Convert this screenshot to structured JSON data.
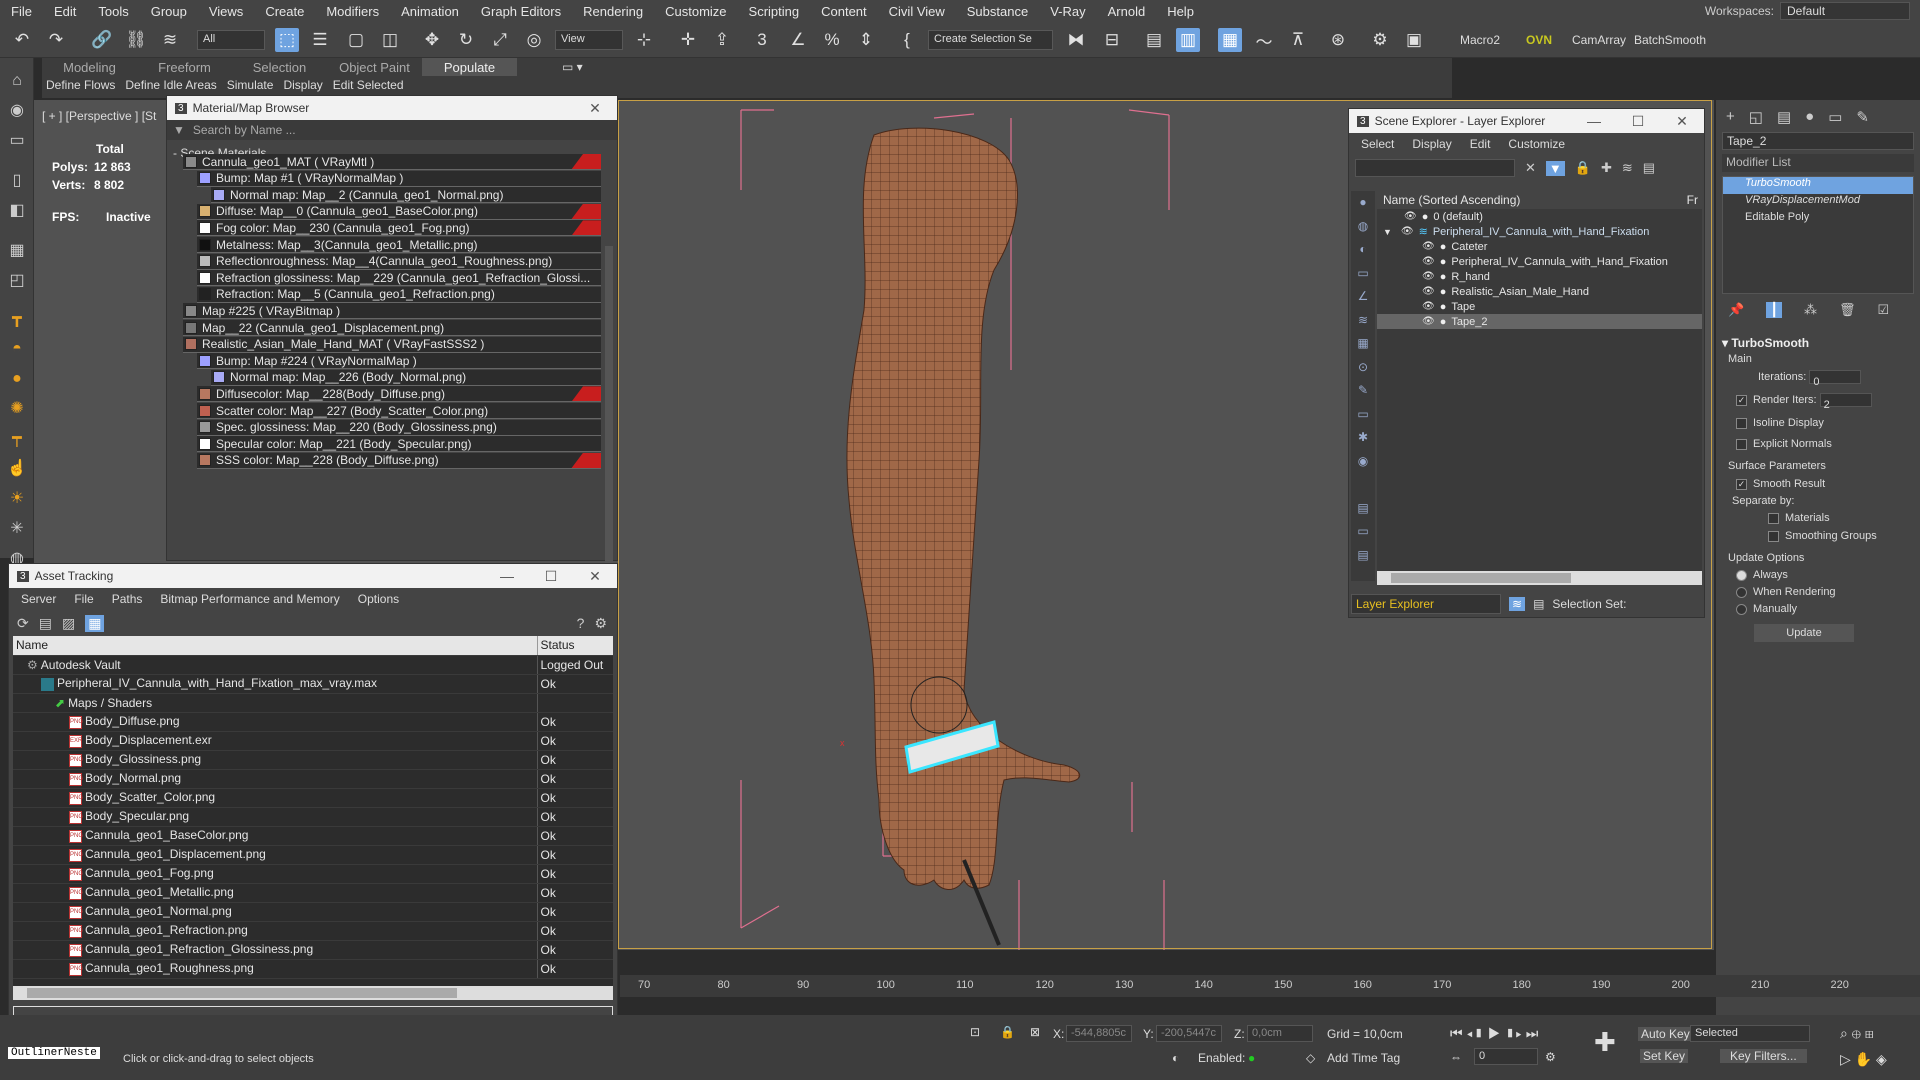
{
  "menubar": {
    "items": [
      "File",
      "Edit",
      "Tools",
      "Group",
      "Views",
      "Create",
      "Modifiers",
      "Animation",
      "Graph Editors",
      "Rendering",
      "Customize",
      "Scripting",
      "Content",
      "Civil View",
      "Substance",
      "V-Ray",
      "Arnold",
      "Help"
    ],
    "workspaces_label": "Workspaces:",
    "workspaces_value": "Default"
  },
  "toolbar": {
    "filter_value": "All",
    "view_value": "View",
    "selection_set": "Create Selection Se",
    "macro2": "Macro2",
    "ovn": "OVN",
    "camarray": "CamArray",
    "batchsmooth": "BatchSmooth"
  },
  "ribbon": {
    "tabs": [
      "Modeling",
      "Freeform",
      "Selection",
      "Object Paint",
      "Populate"
    ],
    "subitems": [
      "Define Flows",
      "Define Idle Areas",
      "Simulate",
      "Display",
      "Edit Selected"
    ]
  },
  "viewport": {
    "label": "[ + ] [Perspective ] [St",
    "stats": {
      "total": "Total",
      "polys_label": "Polys:",
      "polys": "12 863",
      "verts_label": "Verts:",
      "verts": "8 802",
      "fps_label": "FPS:",
      "fps": "Inactive"
    }
  },
  "material_browser": {
    "title": "Material/Map Browser",
    "search_placeholder": "Search by Name ...",
    "section": "- Scene Materials",
    "rows": [
      {
        "text": "Cannula_geo1_MAT  ( VRayMtl )",
        "indent": 0,
        "red": true,
        "swatch": "#8a8a8a"
      },
      {
        "text": "Bump: Map #1  ( VRayNormalMap )",
        "indent": 1,
        "red": false,
        "swatch": "#9da0ff"
      },
      {
        "text": "Normal map: Map__2 (Cannula_geo1_Normal.png)",
        "indent": 2,
        "red": false,
        "swatch": "#a8aaf5"
      },
      {
        "text": "Diffuse: Map__0 (Cannula_geo1_BaseColor.png)",
        "indent": 1,
        "red": true,
        "swatch": "#d8b070"
      },
      {
        "text": "Fog color: Map__230 (Cannula_geo1_Fog.png)",
        "indent": 1,
        "red": true,
        "swatch": "#ffffff"
      },
      {
        "text": "Metalness: Map__3(Cannula_geo1_Metallic.png)",
        "indent": 1,
        "red": false,
        "swatch": "#111111"
      },
      {
        "text": "Reflectionroughness: Map__4(Cannula_geo1_Roughness.png)",
        "indent": 1,
        "red": false,
        "swatch": "#bbbbbb"
      },
      {
        "text": "Refraction glossiness: Map__229 (Cannula_geo1_Refraction_Glossi...",
        "indent": 1,
        "red": false,
        "swatch": "#ffffff"
      },
      {
        "text": "Refraction: Map__5 (Cannula_geo1_Refraction.png)",
        "indent": 1,
        "red": false,
        "swatch": "#222222"
      },
      {
        "text": "Map #225  ( VRayBitmap )",
        "indent": 0,
        "red": false,
        "swatch": "#888888"
      },
      {
        "text": "Map__22 (Cannula_geo1_Displacement.png)",
        "indent": 0,
        "red": false,
        "swatch": "#777777"
      },
      {
        "text": "Realistic_Asian_Male_Hand_MAT  ( VRayFastSSS2 )",
        "indent": 0,
        "red": false,
        "swatch": "#b07060"
      },
      {
        "text": "Bump: Map #224  ( VRayNormalMap )",
        "indent": 1,
        "red": false,
        "swatch": "#9da0ff"
      },
      {
        "text": "Normal map: Map__226 (Body_Normal.png)",
        "indent": 2,
        "red": false,
        "swatch": "#a8aaf5"
      },
      {
        "text": "Diffusecolor: Map__228(Body_Diffuse.png)",
        "indent": 1,
        "red": true,
        "swatch": "#b87860"
      },
      {
        "text": "Scatter color: Map__227 (Body_Scatter_Color.png)",
        "indent": 1,
        "red": false,
        "swatch": "#c06050"
      },
      {
        "text": "Spec. glossiness: Map__220 (Body_Glossiness.png)",
        "indent": 1,
        "red": false,
        "swatch": "#999999"
      },
      {
        "text": "Specular color: Map__221 (Body_Specular.png)",
        "indent": 1,
        "red": false,
        "swatch": "#ffffff"
      },
      {
        "text": "SSS color: Map__228 (Body_Diffuse.png)",
        "indent": 1,
        "red": true,
        "swatch": "#b87860"
      }
    ]
  },
  "asset_tracking": {
    "title": "Asset Tracking",
    "menu": [
      "Server",
      "File",
      "Paths",
      "Bitmap Performance and Memory",
      "Options"
    ],
    "col_name": "Name",
    "col_status": "Status",
    "rows": [
      {
        "name": "Autodesk Vault",
        "status": "Logged Out",
        "indent": 1,
        "icon": "vault"
      },
      {
        "name": "Peripheral_IV_Cannula_with_Hand_Fixation_max_vray.max",
        "status": "Ok",
        "indent": 2,
        "icon": "max"
      },
      {
        "name": "Maps / Shaders",
        "status": "",
        "indent": 3,
        "icon": "folder"
      },
      {
        "name": "Body_Diffuse.png",
        "status": "Ok",
        "indent": 4,
        "icon": "png"
      },
      {
        "name": "Body_Displacement.exr",
        "status": "Ok",
        "indent": 4,
        "icon": "exr"
      },
      {
        "name": "Body_Glossiness.png",
        "status": "Ok",
        "indent": 4,
        "icon": "png"
      },
      {
        "name": "Body_Normal.png",
        "status": "Ok",
        "indent": 4,
        "icon": "png"
      },
      {
        "name": "Body_Scatter_Color.png",
        "status": "Ok",
        "indent": 4,
        "icon": "png"
      },
      {
        "name": "Body_Specular.png",
        "status": "Ok",
        "indent": 4,
        "icon": "png"
      },
      {
        "name": "Cannula_geo1_BaseColor.png",
        "status": "Ok",
        "indent": 4,
        "icon": "png"
      },
      {
        "name": "Cannula_geo1_Displacement.png",
        "status": "Ok",
        "indent": 4,
        "icon": "png"
      },
      {
        "name": "Cannula_geo1_Fog.png",
        "status": "Ok",
        "indent": 4,
        "icon": "png"
      },
      {
        "name": "Cannula_geo1_Metallic.png",
        "status": "Ok",
        "indent": 4,
        "icon": "png"
      },
      {
        "name": "Cannula_geo1_Normal.png",
        "status": "Ok",
        "indent": 4,
        "icon": "png"
      },
      {
        "name": "Cannula_geo1_Refraction.png",
        "status": "Ok",
        "indent": 4,
        "icon": "png"
      },
      {
        "name": "Cannula_geo1_Refraction_Glossiness.png",
        "status": "Ok",
        "indent": 4,
        "icon": "png"
      },
      {
        "name": "Cannula_geo1_Roughness.png",
        "status": "Ok",
        "indent": 4,
        "icon": "png"
      }
    ]
  },
  "scene_explorer": {
    "title": "Scene Explorer - Layer Explorer",
    "menu": [
      "Select",
      "Display",
      "Edit",
      "Customize"
    ],
    "col_header": "Name (Sorted Ascending)",
    "col_fr": "Fr",
    "rows": [
      {
        "name": "0 (default)",
        "indent": 1,
        "selected": false
      },
      {
        "name": "Peripheral_IV_Cannula_with_Hand_Fixation",
        "indent": 1,
        "selected": false,
        "layer": true
      },
      {
        "name": "Cateter",
        "indent": 2,
        "selected": false
      },
      {
        "name": "Peripheral_IV_Cannula_with_Hand_Fixation",
        "indent": 2,
        "selected": false
      },
      {
        "name": "R_hand",
        "indent": 2,
        "selected": false
      },
      {
        "name": "Realistic_Asian_Male_Hand",
        "indent": 2,
        "selected": false
      },
      {
        "name": "Tape",
        "indent": 2,
        "selected": false
      },
      {
        "name": "Tape_2",
        "indent": 2,
        "selected": true
      }
    ],
    "footer_left": "Layer Explorer",
    "footer_right": "Selection Set:"
  },
  "command_panel": {
    "object_name": "Tape_2",
    "modifier_list": "Modifier List",
    "stack": [
      "TurboSmooth",
      "VRayDisplacementMod",
      "Editable Poly"
    ],
    "rollout": "TurboSmooth",
    "main": "Main",
    "iterations_label": "Iterations:",
    "iterations": "0",
    "render_iters_label": "Render Iters:",
    "render_iters": "2",
    "isoline": "Isoline Display",
    "explicit": "Explicit Normals",
    "surface": "Surface Parameters",
    "smooth_result": "Smooth Result",
    "separate": "Separate by:",
    "materials": "Materials",
    "smoothing": "Smoothing Groups",
    "update_options": "Update Options",
    "always": "Always",
    "when_rendering": "When Rendering",
    "manually": "Manually",
    "update_btn": "Update"
  },
  "timeline": {
    "ticks": [
      "70",
      "80",
      "90",
      "100",
      "110",
      "120",
      "130",
      "140",
      "150",
      "160",
      "170",
      "180",
      "190",
      "200",
      "210",
      "220"
    ]
  },
  "statusbar": {
    "maxscript": "OutlinerNeste",
    "prompt": "Click or click-and-drag to select objects",
    "x_label": "X:",
    "x": "-544,8805c",
    "y_label": "Y:",
    "y": "-200,5447c",
    "z_label": "Z:",
    "z": "0,0cm",
    "grid": "Grid = 10,0cm",
    "enabled": "Enabled:",
    "add_time_tag": "Add Time Tag",
    "frame": "0",
    "auto_key": "Auto Key",
    "set_key": "Set Key",
    "selected": "Selected",
    "key_filters": "Key Filters..."
  }
}
